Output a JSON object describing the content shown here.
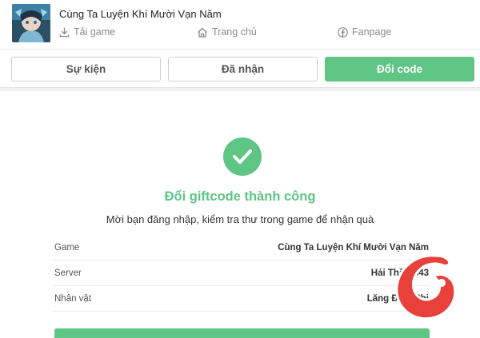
{
  "header": {
    "game_title": "Cùng Ta Luyện Khí Mười Vạn Năm",
    "nav": {
      "download": {
        "label": "Tải game",
        "icon": "download-icon"
      },
      "home": {
        "label": "Trang chủ",
        "icon": "home-icon"
      },
      "fanpage": {
        "label": "Fanpage",
        "icon": "facebook-icon"
      }
    }
  },
  "tabs": {
    "events": "Sự kiện",
    "claimed": "Đã nhận",
    "redeem": "Đổi code",
    "active": "redeem"
  },
  "result": {
    "icon": "check-circle-icon",
    "title": "Đổi giftcode thành công",
    "subtitle": "Mời bạn đăng nhập, kiểm tra thư trong game để nhận quà",
    "rows": [
      {
        "label": "Game",
        "value": "Cùng Ta Luyện Khí Mười Vạn Năm"
      },
      {
        "label": "Server",
        "value": "Hải Thần S43"
      },
      {
        "label": "Nhân vật",
        "value": "Lăng Đình Phi"
      }
    ]
  },
  "colors": {
    "accent": "#5ec585",
    "watermark": "#e8413c"
  }
}
